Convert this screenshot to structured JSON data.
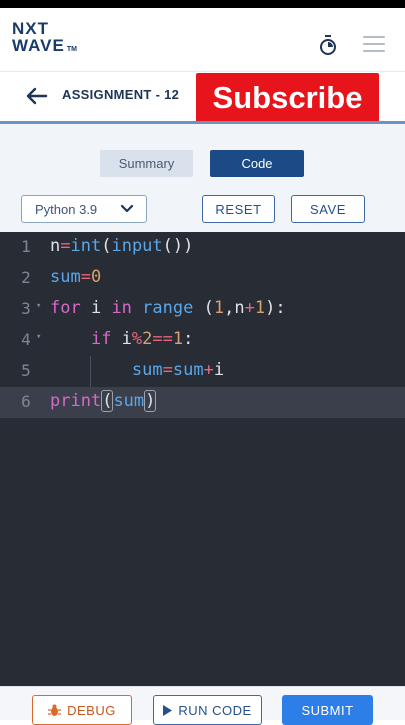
{
  "header": {
    "logo_line1": "NXT",
    "logo_line2": "WAVE",
    "logo_tm": "TM",
    "icons": [
      "timer-icon",
      "hamburger-menu-icon"
    ]
  },
  "titlebar": {
    "back_icon": "arrow-left-icon",
    "title": "ASSIGNMENT - 12"
  },
  "overlay": {
    "subscribe_label": "Subscribe"
  },
  "tabs": [
    {
      "label": "Summary",
      "active": false
    },
    {
      "label": "Code",
      "active": true
    }
  ],
  "toolbar": {
    "language": "Python 3.9",
    "reset_label": "RESET",
    "save_label": "SAVE"
  },
  "editor": {
    "active_line": 6,
    "lines": [
      {
        "num": "1",
        "text": "n=int(input())"
      },
      {
        "num": "2",
        "text": "sum=0"
      },
      {
        "num": "3",
        "text": "for i in range (1,n+1):"
      },
      {
        "num": "4",
        "text": "    if i%2==1:"
      },
      {
        "num": "5",
        "text": "        sum=sum+i"
      },
      {
        "num": "6",
        "text": "print(sum)"
      }
    ]
  },
  "footer": {
    "debug_label": "DEBUG",
    "run_label": "RUN CODE",
    "submit_label": "SUBMIT"
  },
  "colors": {
    "brand_navy": "#183b6b",
    "subscribe_red": "#e8141b",
    "editor_bg": "#282c35",
    "submit_blue": "#2e7ee8",
    "debug_orange": "#d86a2e"
  }
}
